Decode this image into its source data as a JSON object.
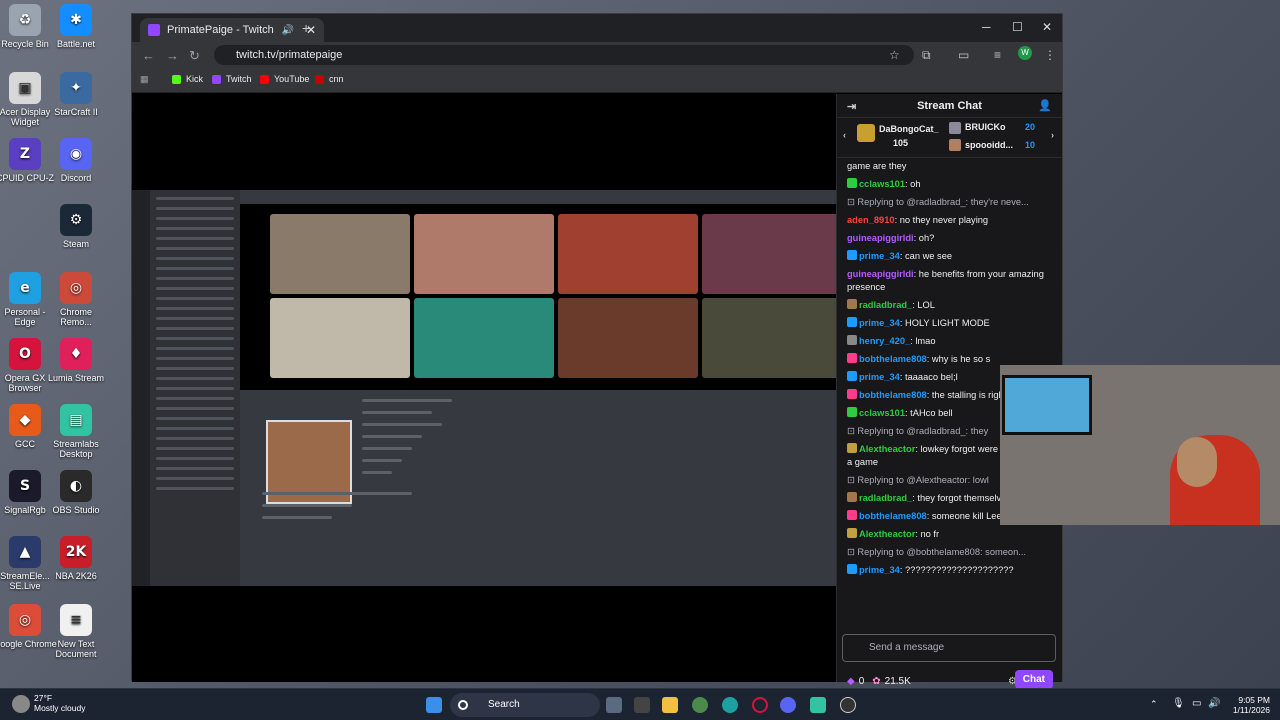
{
  "desktop": {
    "icons": [
      {
        "label": "Recycle Bin",
        "icon": "recycle-bin-icon",
        "color": "#9aa4b0",
        "glyph": "♻"
      },
      {
        "label": "Battle.net",
        "icon": "battlenet-icon",
        "color": "#148eff",
        "glyph": "✱"
      },
      {
        "label": "Acer Display Widget",
        "icon": "acer-display-widget-icon",
        "color": "#d8d8d8",
        "glyph": "▣"
      },
      {
        "label": "StarCraft II",
        "icon": "starcraft-icon",
        "color": "#3a6aa0",
        "glyph": "✦"
      },
      {
        "label": "CPUID CPU-Z",
        "icon": "cpuz-icon",
        "color": "#5a3fc0",
        "glyph": "Z"
      },
      {
        "label": "Discord",
        "icon": "discord-icon",
        "color": "#5865f2",
        "glyph": "◉"
      },
      {
        "label": "Steam",
        "icon": "steam-icon",
        "color": "#1b2838",
        "glyph": "⚙"
      },
      {
        "label": "Personal - Edge",
        "icon": "edge-icon",
        "color": "#1fa0e0",
        "glyph": "e"
      },
      {
        "label": "Chrome Remo...",
        "icon": "chrome-remote-icon",
        "color": "#cc4a3a",
        "glyph": "◎"
      },
      {
        "label": "Opera GX Browser",
        "icon": "opera-gx-icon",
        "color": "#d4143c",
        "glyph": "O"
      },
      {
        "label": "Lumia Stream",
        "icon": "lumia-stream-icon",
        "color": "#e0205a",
        "glyph": "♦"
      },
      {
        "label": "GCC",
        "icon": "gcc-icon",
        "color": "#e85a1a",
        "glyph": "◆"
      },
      {
        "label": "Streamlabs Desktop",
        "icon": "streamlabs-icon",
        "color": "#31c3a2",
        "glyph": "▤"
      },
      {
        "label": "SignalRgb",
        "icon": "signalrgb-icon",
        "color": "#1a1a2a",
        "glyph": "S"
      },
      {
        "label": "OBS Studio",
        "icon": "obs-icon",
        "color": "#2a2a2a",
        "glyph": "◐"
      },
      {
        "label": "StreamEle... SE.Live",
        "icon": "streamelements-icon",
        "color": "#2a3a6a",
        "glyph": "▲"
      },
      {
        "label": "NBA 2K26",
        "icon": "nba2k-icon",
        "color": "#c81e2a",
        "glyph": "2K"
      },
      {
        "label": "Google Chrome",
        "icon": "chrome-icon",
        "color": "#dd4b39",
        "glyph": "◎"
      },
      {
        "label": "New Text Document",
        "icon": "text-document-icon",
        "color": "#f0f0f0",
        "glyph": "≡"
      }
    ]
  },
  "browser": {
    "tab_title": "PrimatePaige - Twitch",
    "url": "twitch.tv/primatepaige",
    "bookmarks": [
      {
        "label": "Kick",
        "color": "#53fc18"
      },
      {
        "label": "Twitch",
        "color": "#9147ff"
      },
      {
        "label": "YouTube",
        "color": "#ff0000"
      },
      {
        "label": "cnn",
        "color": "#cc0000"
      }
    ]
  },
  "chat": {
    "title": "Stream Chat",
    "gifts": [
      {
        "name": "DaBongoCat_",
        "count": "105"
      },
      {
        "name": "BRUICKo",
        "count": "20"
      },
      {
        "name": "spoooidd...",
        "count": "10"
      }
    ],
    "messages": [
      {
        "user": "",
        "text": "game are they",
        "color": "#efeff1",
        "badge": ""
      },
      {
        "user": "cclaws101",
        "text": ": oh",
        "color": "#2ecc40",
        "badge": "#2ecc40"
      },
      {
        "user": "",
        "text": "Replying to @radladbrad_: they're neve...",
        "color": "#adadb8",
        "reply": true
      },
      {
        "user": "aden_8910",
        "text": ": no they never playing",
        "color": "#ff4040",
        "badge": ""
      },
      {
        "user": "guineapiggirldi",
        "text": ": oh?",
        "color": "#b45cff",
        "badge": ""
      },
      {
        "user": "prime_34",
        "text": ": can we see",
        "color": "#1e9bff",
        "badge": "#1e9bff"
      },
      {
        "user": "guineapiggirldi",
        "text": ": he benefits from your amazing presence",
        "color": "#b45cff",
        "badge": ""
      },
      {
        "user": "radladbrad_",
        "text": ": LOL",
        "color": "#2ecc40",
        "badge": "#a07850"
      },
      {
        "user": "prime_34",
        "text": ": HOLY LIGHT MODE",
        "color": "#1e9bff",
        "badge": "#1e9bff"
      },
      {
        "user": "henry_420_",
        "text": ": lmao",
        "color": "#1e9bff",
        "badge": "#888"
      },
      {
        "user": "bobthelame808",
        "text": ": why is he so s",
        "color": "#1e9bff",
        "badge": "#ff3c8c"
      },
      {
        "user": "prime_34",
        "text": ": taaaaco bel;l",
        "color": "#1e9bff",
        "badge": "#1e9bff"
      },
      {
        "user": "bobthelame808",
        "text": ": the stalling is right now",
        "color": "#1e9bff",
        "badge": "#ff3c8c"
      },
      {
        "user": "cclaws101",
        "text": ": tAHco bell",
        "color": "#2ecc40",
        "badge": "#2ecc40"
      },
      {
        "user": "",
        "text": "Replying to @radladbrad_: they",
        "color": "#adadb8",
        "reply": true
      },
      {
        "user": "Alextheactor",
        "text": ": lowkey forgot were gonna play a game",
        "color": "#2ecc40",
        "badge": "#c0a040"
      },
      {
        "user": "",
        "text": "Replying to @Alextheactor: lowl",
        "color": "#adadb8",
        "reply": true
      },
      {
        "user": "radladbrad_",
        "text": ": they forgot themselves",
        "color": "#2ecc40",
        "badge": "#a07850"
      },
      {
        "user": "bobthelame808",
        "text": ": someone kill Lee",
        "color": "#1e9bff",
        "badge": "#ff3c8c"
      },
      {
        "user": "Alextheactor",
        "text": ": no fr",
        "color": "#2ecc40",
        "badge": "#c0a040"
      },
      {
        "user": "",
        "text": "Replying to @bobthelame808: someon...",
        "color": "#adadb8",
        "reply": true
      },
      {
        "user": "prime_34",
        "text": ": ?????????????????????",
        "color": "#1e9bff",
        "badge": "#1e9bff"
      }
    ],
    "input_placeholder": "Send a message",
    "points_bits": "0",
    "points_channel": "21.5K",
    "chat_button": "Chat"
  },
  "taskbar": {
    "weather_temp": "27°F",
    "weather_desc": "Mostly cloudy",
    "search_label": "Search",
    "time": "9:05 PM",
    "date": "1/11/2026"
  }
}
